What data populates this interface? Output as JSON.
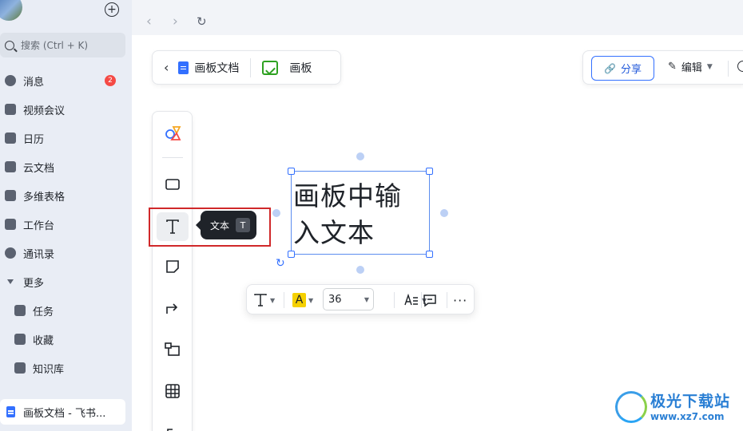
{
  "sidebar": {
    "search_placeholder": "搜索 (Ctrl + K)",
    "items": [
      {
        "label": "消息",
        "badge": "2"
      },
      {
        "label": "视频会议"
      },
      {
        "label": "日历"
      },
      {
        "label": "云文档"
      },
      {
        "label": "多维表格"
      },
      {
        "label": "工作台"
      },
      {
        "label": "通讯录"
      },
      {
        "label": "更多"
      },
      {
        "label": "任务"
      },
      {
        "label": "收藏"
      },
      {
        "label": "知识库"
      }
    ],
    "open_doc": "画板文档 - 飞书..."
  },
  "header": {
    "doc_title": "画板文档",
    "board_label": "画板"
  },
  "actions": {
    "share_label": "分享",
    "edit_label": "编辑"
  },
  "tooltip": {
    "label": "文本",
    "shortcut": "T"
  },
  "canvas": {
    "text_line1": "画板中输",
    "text_line2": "入文本"
  },
  "format_toolbar": {
    "font_size": "36"
  },
  "watermark": {
    "title": "极光下载站",
    "url": "www.xz7.com"
  },
  "colors": {
    "accent": "#3370ff",
    "badge": "#f54a45",
    "highlight_box": "#d0282a",
    "text_highlight": "#f5d000"
  }
}
